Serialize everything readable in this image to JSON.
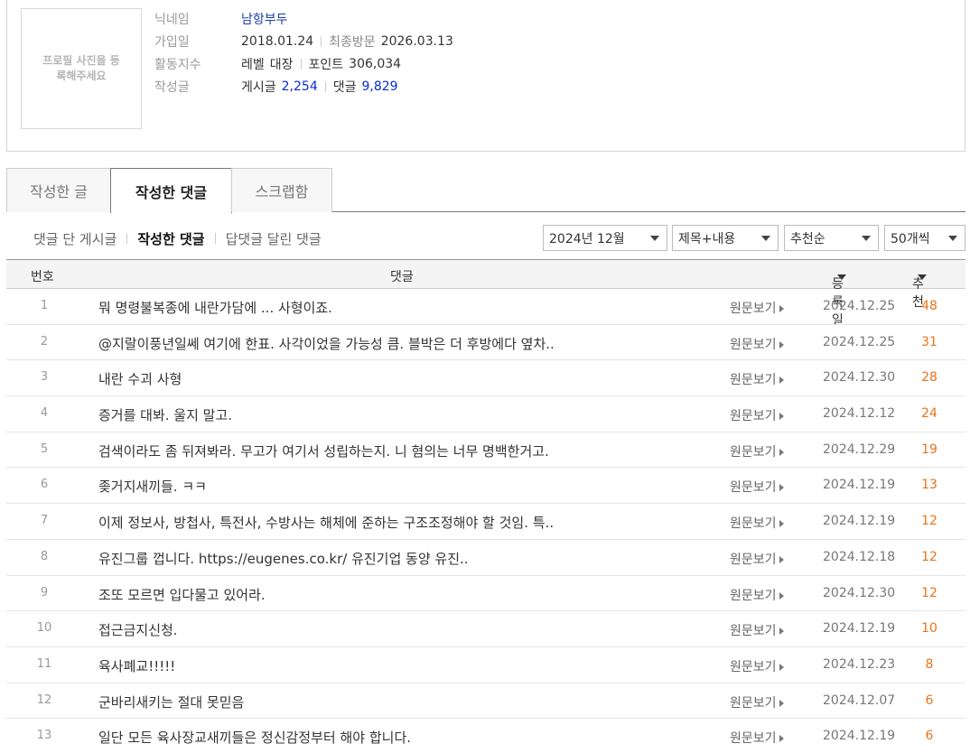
{
  "profile": {
    "photo_placeholder": "프로필 사진을 등록해주세요",
    "nickname_label": "닉네임",
    "nickname": "남항부두",
    "join_label": "가입일",
    "join_date": "2018.01.24",
    "last_visit_label": "최종방문",
    "last_visit": "2026.03.13",
    "activity_label": "활동지수",
    "level_label": "레벨",
    "level": "대장",
    "points_label": "포인트",
    "points": "306,034",
    "writings_label": "작성글",
    "posts_label": "게시글",
    "posts": "2,254",
    "comments_label": "댓글",
    "comments": "9,829"
  },
  "tabs": [
    "작성한 글",
    "작성한 댓글",
    "스크랩함"
  ],
  "subnav": [
    "댓글 단 게시글",
    "작성한 댓글",
    "답댓글 달린 댓글"
  ],
  "filters": {
    "month": "2024년 12월",
    "scope": "제목+내용",
    "sort": "추천순",
    "count": "50개씩"
  },
  "table": {
    "headers": {
      "num": "번호",
      "comment": "댓글",
      "date": "등록일",
      "rec": "추천"
    },
    "original_label": "원문보기",
    "rows": [
      {
        "num": "1",
        "comment": "뭐 명령불복종에 내란가담에 ... 사형이죠.",
        "date": "2024.12.25",
        "rec": "48"
      },
      {
        "num": "2",
        "comment": "@지랄이풍년일쎄 여기에 한표. 사각이었을 가능성 큼. 블박은 더 후방에다 옆차..",
        "date": "2024.12.25",
        "rec": "31"
      },
      {
        "num": "3",
        "comment": "내란 수괴 사형",
        "date": "2024.12.30",
        "rec": "28"
      },
      {
        "num": "4",
        "comment": "증거를 대봐. 울지 말고.",
        "date": "2024.12.12",
        "rec": "24"
      },
      {
        "num": "5",
        "comment": "검색이라도 좀 뒤져봐라. 무고가 여기서 성립하는지. 니 혐의는 너무 명백한거고.",
        "date": "2024.12.29",
        "rec": "19"
      },
      {
        "num": "6",
        "comment": "좆거지새끼들. ㅋㅋ",
        "date": "2024.12.19",
        "rec": "13"
      },
      {
        "num": "7",
        "comment": "이제 정보사, 방첩사, 특전사, 수방사는 해체에 준하는 구조조정해야 할 것임. 특..",
        "date": "2024.12.19",
        "rec": "12"
      },
      {
        "num": "8",
        "comment": "유진그룹 껍니다. https://eugenes.co.kr/ 유진기업 동양 유진..",
        "date": "2024.12.18",
        "rec": "12"
      },
      {
        "num": "9",
        "comment": "조또 모르면 입다물고 있어라.",
        "date": "2024.12.30",
        "rec": "12"
      },
      {
        "num": "10",
        "comment": "접근금지신청.",
        "date": "2024.12.19",
        "rec": "10"
      },
      {
        "num": "11",
        "comment": "육사폐교!!!!!",
        "date": "2024.12.23",
        "rec": "8"
      },
      {
        "num": "12",
        "comment": "군바리새키는 절대 못믿음",
        "date": "2024.12.07",
        "rec": "6"
      },
      {
        "num": "13",
        "comment": "일단 모든 육사장교새끼들은 정신감정부터 해야 합니다.",
        "date": "2024.12.19",
        "rec": "6"
      }
    ]
  }
}
